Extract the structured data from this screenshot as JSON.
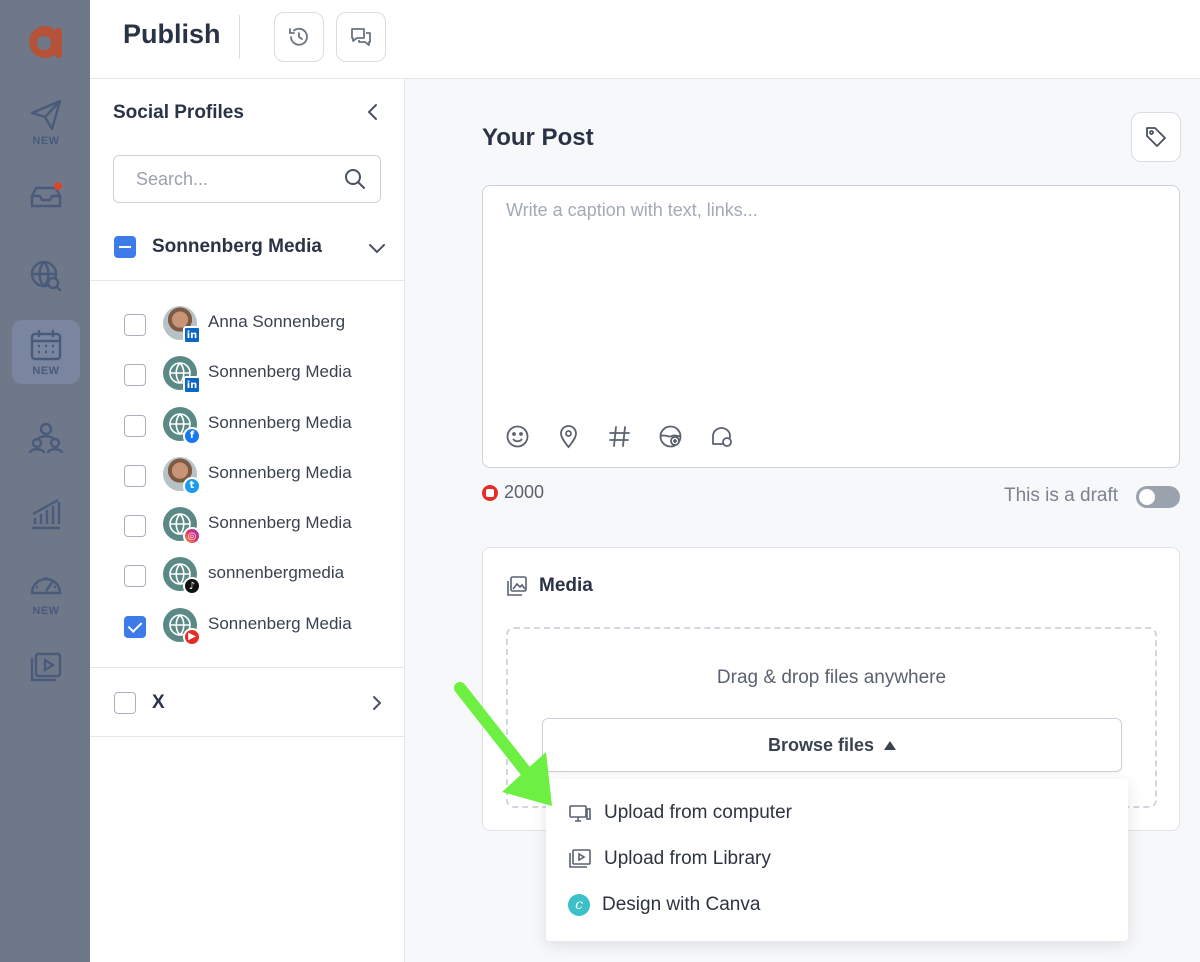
{
  "app": {
    "page_title": "Publish",
    "logo_letter": "a",
    "accent": "#3d7be8",
    "brand": "#b4533a"
  },
  "rail": {
    "items": [
      {
        "icon": "send-icon",
        "tag": "NEW"
      },
      {
        "icon": "inbox-icon",
        "tag": ""
      },
      {
        "icon": "globe-search-icon",
        "tag": ""
      },
      {
        "icon": "calendar-icon",
        "tag": "NEW",
        "active": true
      },
      {
        "icon": "team-icon",
        "tag": ""
      },
      {
        "icon": "analytics-icon",
        "tag": ""
      },
      {
        "icon": "gauge-icon",
        "tag": "NEW"
      },
      {
        "icon": "media-library-icon",
        "tag": ""
      }
    ]
  },
  "profiles": {
    "title": "Social Profiles",
    "search_placeholder": "Search...",
    "group_name": "Sonnenberg Media",
    "items": [
      {
        "name": "Anna Sonnenberg",
        "network": "linkedin",
        "checked": false
      },
      {
        "name": "Sonnenberg Media",
        "network": "linkedin",
        "checked": false
      },
      {
        "name": "Sonnenberg Media",
        "network": "facebook",
        "checked": false
      },
      {
        "name": "Sonnenberg Media",
        "network": "twitter",
        "checked": false
      },
      {
        "name": "Sonnenberg Media",
        "network": "instagram",
        "checked": false
      },
      {
        "name": "sonnenbergmedia",
        "network": "tiktok",
        "checked": false
      },
      {
        "name": "Sonnenberg Media",
        "network": "youtube",
        "checked": true
      }
    ],
    "x_group": "X"
  },
  "post": {
    "title": "Your Post",
    "caption_placeholder": "Write a caption with text, links...",
    "char_count": "2000",
    "draft_label": "This is a draft"
  },
  "media": {
    "title": "Media",
    "drop_text": "Drag & drop files anywhere",
    "browse_label": "Browse files",
    "menu": [
      {
        "label": "Upload from computer",
        "icon": "monitor-icon"
      },
      {
        "label": "Upload from Library",
        "icon": "library-icon"
      },
      {
        "label": "Design with Canva",
        "icon": "canva-icon"
      }
    ]
  }
}
